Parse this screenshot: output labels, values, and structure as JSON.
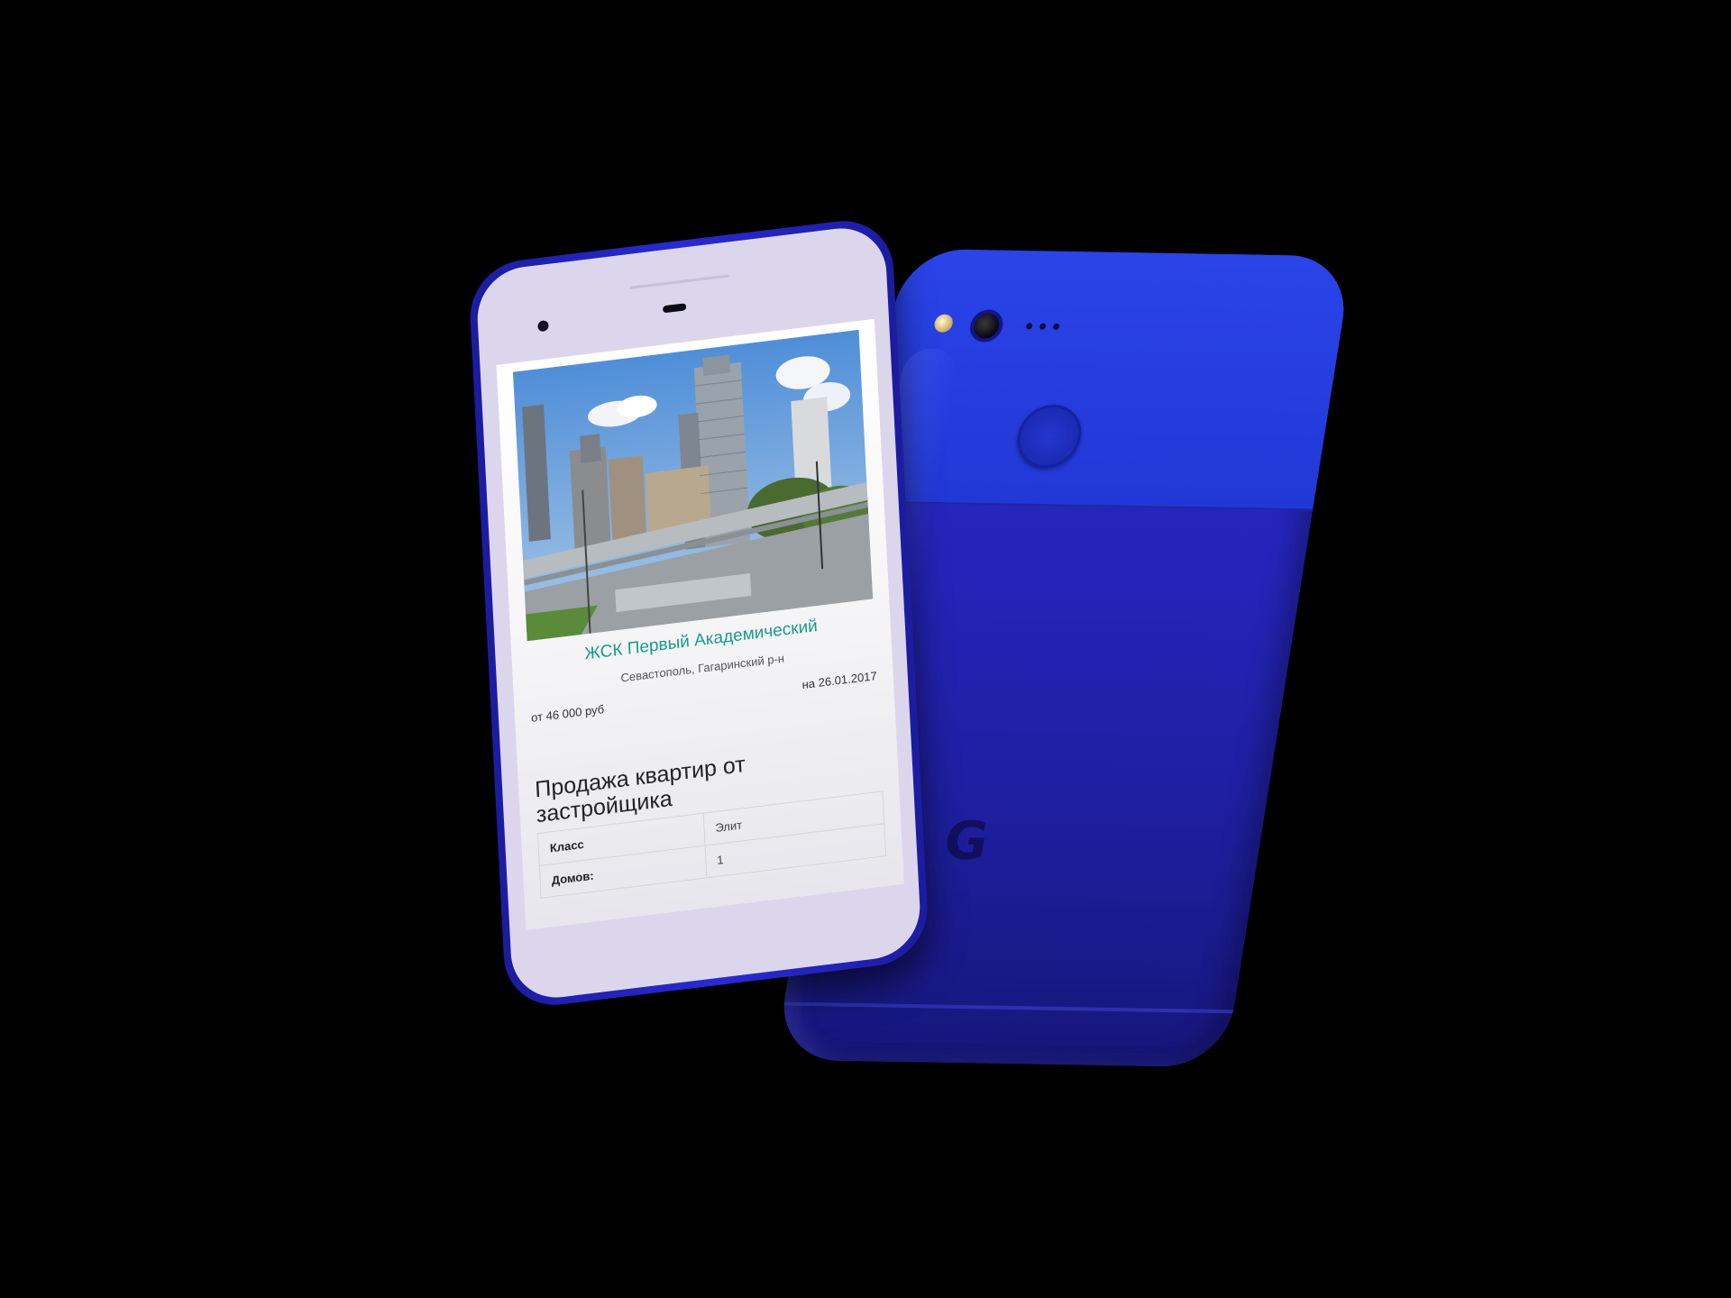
{
  "back_phone": {
    "brand_mark": "G",
    "colors": {
      "body": "#2424b8",
      "glass": "#2a44e8",
      "logo": "#10105e"
    }
  },
  "listing": {
    "title": "ЖСК Первый Академический",
    "location": "Севастополь, Гагаринский р-н",
    "price_from": "от 46 000 руб",
    "price_date": "на 26.01.2017",
    "title_color": "#1a9a8a"
  },
  "details": {
    "heading": "Продажа квартир от застройщика",
    "rows": [
      {
        "label": "Класс",
        "value": "Элит"
      },
      {
        "label": "Домов:",
        "value": "1"
      }
    ]
  },
  "icons": {
    "front_camera": "front-camera-icon",
    "earpiece": "earpiece-icon",
    "rear_camera": "rear-camera-icon",
    "flash": "flash-icon",
    "fingerprint": "fingerprint-sensor-icon",
    "brand_logo": "google-g-logo-icon"
  }
}
